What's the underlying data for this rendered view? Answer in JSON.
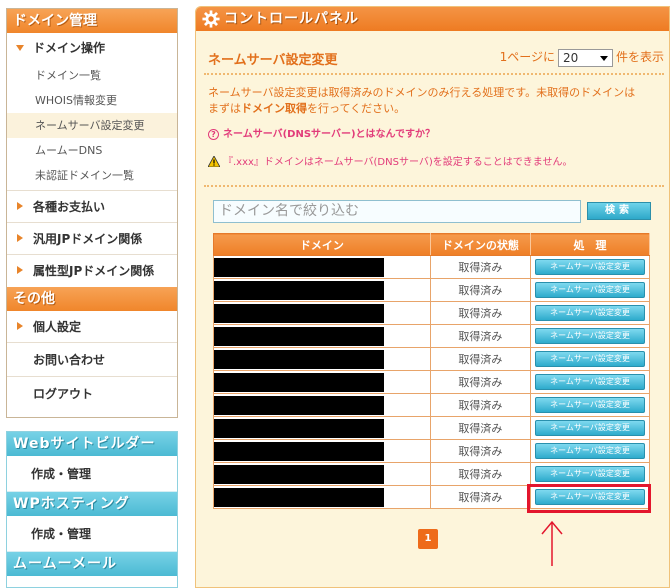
{
  "sidebar": {
    "domain_header": "ドメイン管理",
    "domain_ops": {
      "label": "ドメイン操作",
      "items": [
        "ドメイン一覧",
        "WHOIS情報変更",
        "ネームサーバ設定変更",
        "ムームーDNS",
        "未認証ドメイン一覧"
      ],
      "active_index": 2
    },
    "groups": [
      "各種お支払い",
      "汎用JPドメイン関係",
      "属性型JPドメイン関係"
    ],
    "other_header": "その他",
    "personal_settings": "個人設定",
    "contact": "お問い合わせ",
    "logout": "ログアウト",
    "services": [
      {
        "header": "Webサイトビルダー",
        "link": "作成・管理"
      },
      {
        "header": "WPホスティング",
        "link": "作成・管理"
      },
      {
        "header": "ムームーメール"
      }
    ]
  },
  "panel": {
    "title": "コントロールパネル",
    "section_title": "ネームサーバ設定変更",
    "per_page_prefix": "1ページに",
    "per_page_value": "20",
    "per_page_suffix": "件を表示",
    "desc_line1": "ネームサーバ設定変更は取得済みのドメインのみ行える処理です。未取得のドメインは",
    "desc_line2_a": "まずは",
    "desc_line2_b": "ドメイン取得",
    "desc_line2_c": "を行ってください。",
    "help_link": "ネームサーバ(DNSサーバー)とはなんですか？",
    "warning": "『.xxx』ドメインはネームサーバ(DNSサーバ)を設定することはできません。",
    "search_placeholder": "ドメイン名で絞り込む",
    "search_button": "検索"
  },
  "table": {
    "headers": [
      "ドメイン",
      "ドメインの状態",
      "処　理"
    ],
    "rows": [
      {
        "status": "取得済み",
        "action": "ネームサーバ設定変更"
      },
      {
        "status": "取得済み",
        "action": "ネームサーバ設定変更"
      },
      {
        "status": "取得済み",
        "action": "ネームサーバ設定変更"
      },
      {
        "status": "取得済み",
        "action": "ネームサーバ設定変更"
      },
      {
        "status": "取得済み",
        "action": "ネームサーバ設定変更"
      },
      {
        "status": "取得済み",
        "action": "ネームサーバ設定変更"
      },
      {
        "status": "取得済み",
        "action": "ネームサーバ設定変更"
      },
      {
        "status": "取得済み",
        "action": "ネームサーバ設定変更"
      },
      {
        "status": "取得済み",
        "action": "ネームサーバ設定変更"
      },
      {
        "status": "取得済み",
        "action": "ネームサーバ設定変更"
      },
      {
        "status": "取得済み",
        "action": "ネームサーバ設定変更"
      }
    ]
  },
  "pagination": {
    "current": "1"
  },
  "colors": {
    "accent_orange": "#ee7b22",
    "accent_blue": "#4bbad3",
    "highlight_red": "#e3162d",
    "panel_bg": "#fdf5db"
  }
}
